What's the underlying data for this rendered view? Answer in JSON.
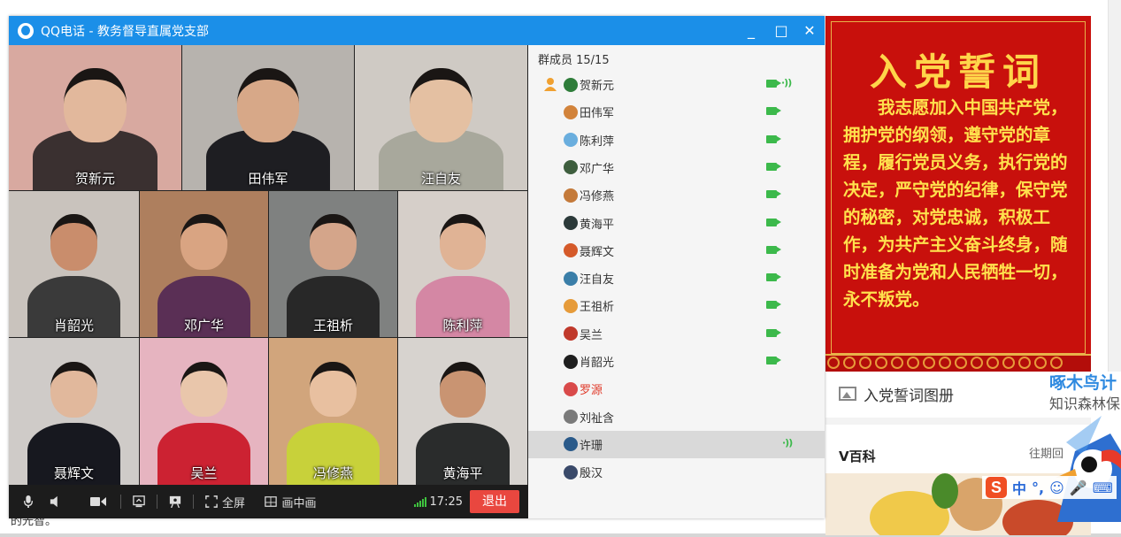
{
  "window": {
    "title": "QQ电话 - 教务督导直属党支部",
    "minimize": "_",
    "maximize": "□",
    "close": "✕"
  },
  "video_tiles": [
    {
      "name": "贺新元",
      "bg": "#d8a9a0",
      "skin": "#e2b89c",
      "cloth": "#3a3030"
    },
    {
      "name": "田伟军",
      "bg": "#b7b3ae",
      "skin": "#d7a888",
      "cloth": "#1e1e22"
    },
    {
      "name": "汪自友",
      "bg": "#cfcac4",
      "skin": "#e4c0a2",
      "cloth": "#a8a89c"
    },
    {
      "name": "肖韶光",
      "bg": "#c9c3bd",
      "skin": "#c98d6c",
      "cloth": "#3a3a3a"
    },
    {
      "name": "邓广华",
      "bg": "#ae7f5e",
      "skin": "#d9a482",
      "cloth": "#5a2f55"
    },
    {
      "name": "王祖析",
      "bg": "#7f8180",
      "skin": "#d4a58a",
      "cloth": "#282828"
    },
    {
      "name": "陈利萍",
      "bg": "#d6cfc9",
      "skin": "#e0b395",
      "cloth": "#d487a4"
    },
    {
      "name": "聂辉文",
      "bg": "#cfcbc8",
      "skin": "#e1b89c",
      "cloth": "#17181f"
    },
    {
      "name": "吴兰",
      "bg": "#e6b4c0",
      "skin": "#e9c6ab",
      "cloth": "#cc2232"
    },
    {
      "name": "冯修燕",
      "bg": "#d1a57c",
      "skin": "#e8c0a0",
      "cloth": "#c8d13a"
    },
    {
      "name": "黄海平",
      "bg": "#d7d3cf",
      "skin": "#c99472",
      "cloth": "#2a2c2c"
    }
  ],
  "controls": {
    "fullscreen_label": "全屏",
    "pip_label": "画中画",
    "time": "17:25",
    "exit_label": "退出"
  },
  "members": {
    "header": "群成员 15/15",
    "list": [
      {
        "name": "贺新元",
        "avatar": "#2f7d3a",
        "camera": true,
        "speaking": true,
        "host": true,
        "red": false
      },
      {
        "name": "田伟军",
        "avatar": "#d2833b",
        "camera": true,
        "speaking": false,
        "host": false,
        "red": false
      },
      {
        "name": "陈利萍",
        "avatar": "#6aaede",
        "camera": true,
        "speaking": false,
        "host": false,
        "red": false
      },
      {
        "name": "邓广华",
        "avatar": "#3e5e3e",
        "camera": true,
        "speaking": false,
        "host": false,
        "red": false
      },
      {
        "name": "冯修燕",
        "avatar": "#c47a3a",
        "camera": true,
        "speaking": false,
        "host": false,
        "red": false
      },
      {
        "name": "黄海平",
        "avatar": "#2c3a3a",
        "camera": true,
        "speaking": false,
        "host": false,
        "red": false
      },
      {
        "name": "聂辉文",
        "avatar": "#d55a2a",
        "camera": true,
        "speaking": false,
        "host": false,
        "red": false
      },
      {
        "name": "汪自友",
        "avatar": "#3a7ea8",
        "camera": true,
        "speaking": false,
        "host": false,
        "red": false
      },
      {
        "name": "王祖析",
        "avatar": "#e69b3a",
        "camera": true,
        "speaking": false,
        "host": false,
        "red": false
      },
      {
        "name": "吴兰",
        "avatar": "#c0392b",
        "camera": true,
        "speaking": false,
        "host": false,
        "red": false
      },
      {
        "name": "肖韶光",
        "avatar": "#1e1e1e",
        "camera": true,
        "speaking": false,
        "host": false,
        "red": false
      },
      {
        "name": "罗源",
        "avatar": "#d94a4a",
        "camera": false,
        "speaking": false,
        "host": false,
        "red": true
      },
      {
        "name": "刘祉含",
        "avatar": "#7a7a7a",
        "camera": false,
        "speaking": false,
        "host": false,
        "red": false
      },
      {
        "name": "许珊",
        "avatar": "#2a5a8a",
        "camera": false,
        "speaking": true,
        "host": false,
        "red": false,
        "selected": true
      },
      {
        "name": "殷汉",
        "avatar": "#3a4a6a",
        "camera": false,
        "speaking": false,
        "host": false,
        "red": false
      }
    ]
  },
  "oath": {
    "title": "入党誓词",
    "body": "我志愿加入中国共产党，拥护党的纲领，遵守党的章程，履行党员义务，执行党的决定，严守党的纪律，保守党的秘密，对党忠诚，积极工作，为共产主义奋斗终身，随时准备为党和人民牺牲一切，永不叛党。"
  },
  "side": {
    "album_label": "入党誓词图册",
    "vbaike_label": "V百科",
    "past_label": "往期回",
    "wood_title": "啄木鸟计",
    "wood_sub": "知识森林保"
  },
  "ime": {
    "logo": "S",
    "mode": "中",
    "punct": "°,",
    "emoji": "☺",
    "voice": "🎤",
    "keyboard": "⌨"
  },
  "background": {
    "cut_text": "的光智。"
  },
  "colors": {
    "titlebar": "#1b8fe8",
    "exit": "#e9473f",
    "active_green": "#3cb94b",
    "oath_red": "#c8100c",
    "oath_text": "#ffe14d"
  }
}
